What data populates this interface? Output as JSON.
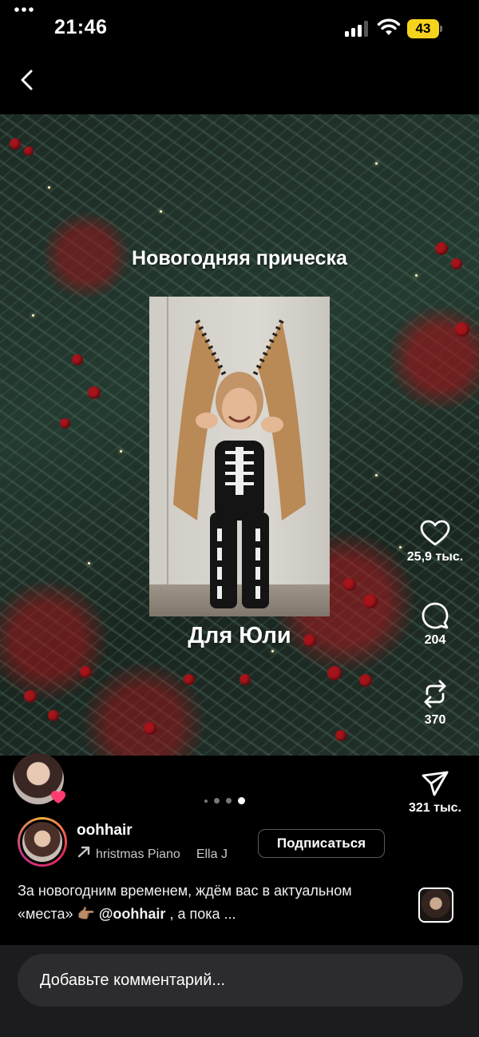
{
  "status_bar": {
    "time": "21:46",
    "battery": "43"
  },
  "post": {
    "overlay_title_top": "Новогодняя прическа",
    "overlay_title_bottom": "Для Юли"
  },
  "actions": {
    "likes": "25,9 тыс.",
    "comments": "204",
    "reposts": "370",
    "shares": "321 тыс."
  },
  "pager": {
    "count": 4,
    "active_index": 3
  },
  "author": {
    "username": "oohhair",
    "music_track": "hristmas Piano",
    "music_artist": "Ella J",
    "follow_label": "Подписаться"
  },
  "caption": {
    "text_before": "За новогодним временем, ждём вас в актуальном «места» 👉🏽 ",
    "mention": "@oohhair",
    "text_after": " , а пока ..."
  },
  "comment": {
    "placeholder": "Добавьте комментарий..."
  },
  "icons": {
    "back": "chevron-left-icon",
    "like": "heart-icon",
    "comment": "comment-bubble-icon",
    "repost": "repost-icon",
    "share": "paper-plane-icon",
    "more": "more-horizontal-icon"
  }
}
